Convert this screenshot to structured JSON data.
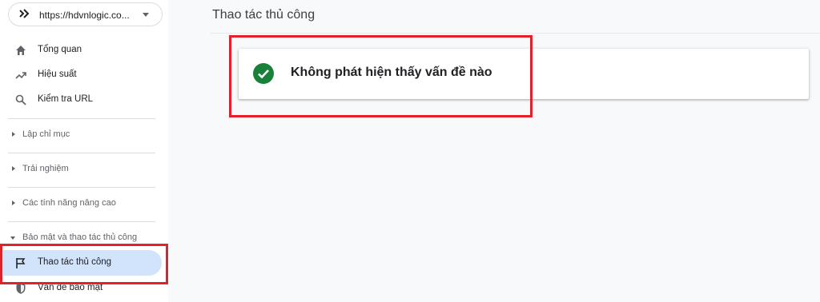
{
  "property": {
    "url": "https://hdvnlogic.co..."
  },
  "nav": {
    "overview": "Tổng quan",
    "performance": "Hiệu suất",
    "url_inspection": "Kiểm tra URL",
    "indexing": "Lập chỉ mục",
    "experience": "Trải nghiệm",
    "enhancements": "Các tính năng nâng cao",
    "security_section": "Bảo mật và thao tác thủ công",
    "manual_actions": "Thao tác thủ công",
    "security_issues": "Vấn đề bảo mật"
  },
  "main": {
    "title": "Thao tác thủ công",
    "status_message": "Không phát hiện thấy vấn đề nào"
  },
  "colors": {
    "accent_active": "#d2e3fc",
    "success": "#188038",
    "highlight": "#e3212a"
  }
}
